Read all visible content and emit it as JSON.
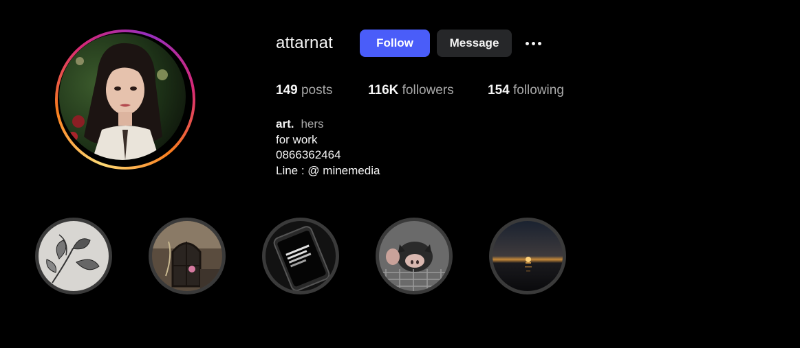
{
  "profile": {
    "username": "attarnat",
    "avatar_icon": "profile-photo",
    "story_ring_colors": [
      "#feda75",
      "#fa7e1e",
      "#d62976",
      "#962fbf"
    ]
  },
  "actions": {
    "follow_label": "Follow",
    "message_label": "Message",
    "more_icon": "more-horizontal-icon"
  },
  "stats": {
    "posts_count": "149",
    "posts_label": "posts",
    "followers_count": "116K",
    "followers_label": "followers",
    "following_count": "154",
    "following_label": "following"
  },
  "bio": {
    "name": "art.",
    "pronouns": "hers",
    "lines": [
      "for work",
      "0866362464",
      "Line : @ minemedia"
    ]
  },
  "highlights": [
    {
      "icon": "flower-sketch-highlight"
    },
    {
      "icon": "mirror-room-highlight"
    },
    {
      "icon": "phone-screen-highlight"
    },
    {
      "icon": "piglet-highlight"
    },
    {
      "icon": "sunset-sea-highlight"
    }
  ],
  "colors": {
    "background": "#000000",
    "follow_button": "#4a5df9",
    "message_button": "#262729",
    "secondary_text": "#a8a8a8"
  }
}
